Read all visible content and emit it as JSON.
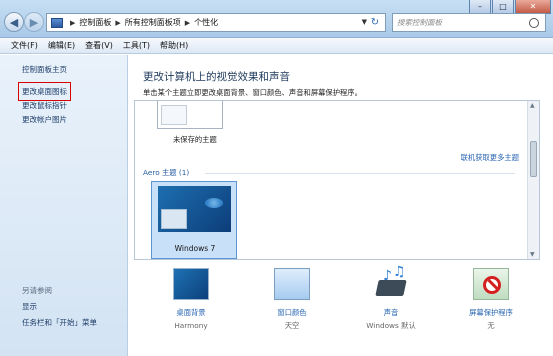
{
  "breadcrumbs": [
    "控制面板",
    "所有控制面板项",
    "个性化"
  ],
  "search_placeholder": "搜索控制面板",
  "window_controls": {
    "minimize": "–",
    "maximize": "□",
    "close": "✕"
  },
  "menu": [
    "文件(F)",
    "编辑(E)",
    "查看(V)",
    "工具(T)",
    "帮助(H)"
  ],
  "sidebar": {
    "home": "控制面板主页",
    "links": [
      "更改桌面图标",
      "更改鼠标指针",
      "更改帐户图片"
    ],
    "see_also_title": "另请参阅",
    "see_also": [
      "显示",
      "任务栏和「开始」菜单"
    ]
  },
  "main": {
    "title": "更改计算机上的视觉效果和声音",
    "description": "单击某个主题立即更改桌面背景、窗口颜色、声音和屏幕保护程序。",
    "unsaved_theme": "未保存的主题",
    "online_link": "联机获取更多主题",
    "aero_group": "Aero 主题 (1)",
    "selected_theme": "Windows 7"
  },
  "bottom": [
    {
      "title": "桌面背景",
      "value": "Harmony",
      "icon": "desktop-background-icon"
    },
    {
      "title": "窗口颜色",
      "value": "天空",
      "icon": "window-color-icon"
    },
    {
      "title": "声音",
      "value": "Windows 默认",
      "icon": "sound-icon"
    },
    {
      "title": "屏幕保护程序",
      "value": "无",
      "icon": "screensaver-icon"
    }
  ],
  "colors": {
    "accent_link": "#2764b2",
    "highlight_border": "#d90000"
  }
}
